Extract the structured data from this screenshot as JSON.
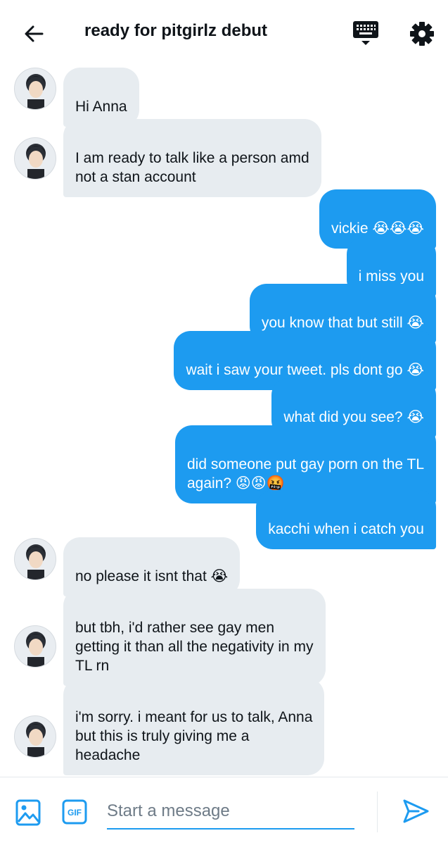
{
  "header": {
    "title": "ready for pitgirlz debut",
    "back_icon": "arrow-left-icon",
    "keyboard_icon": "keyboard-icon",
    "settings_icon": "gear-icon"
  },
  "messages": [
    {
      "side": "in",
      "text": "Hi Anna"
    },
    {
      "side": "in",
      "text": "I am ready to talk like a person amd\nnot a stan account"
    },
    {
      "side": "out",
      "text": "vickie ",
      "emoji": "😭😭😭"
    },
    {
      "side": "out",
      "text": "i miss you"
    },
    {
      "side": "out",
      "text": "you know that but still ",
      "emoji": "😭"
    },
    {
      "side": "out",
      "text": "wait i saw your tweet. pls dont go ",
      "emoji": "😭"
    },
    {
      "side": "out",
      "text": "what did you see? ",
      "emoji": "😭"
    },
    {
      "side": "out",
      "text": "did someone put gay porn on the TL\nagain? ",
      "emoji": "😡😡🤬"
    },
    {
      "side": "out",
      "text": "kacchi when i catch you"
    },
    {
      "side": "in",
      "text": "no please it isnt that ",
      "emoji": "😭"
    },
    {
      "side": "in",
      "text": "but tbh, i'd rather see gay men\ngetting it than all the negativity in my\nTL rn"
    },
    {
      "side": "in",
      "text": "i'm sorry. i meant for us to talk, Anna\nbut this is truly giving me a\nheadache"
    }
  ],
  "composer": {
    "placeholder": "Start a message",
    "gif_label": "GIF",
    "image_icon": "image-icon",
    "send_icon": "send-icon"
  },
  "colors": {
    "accent": "#1d9bf0",
    "incoming_bubble": "#e7ecf0",
    "text": "#0f1419"
  }
}
